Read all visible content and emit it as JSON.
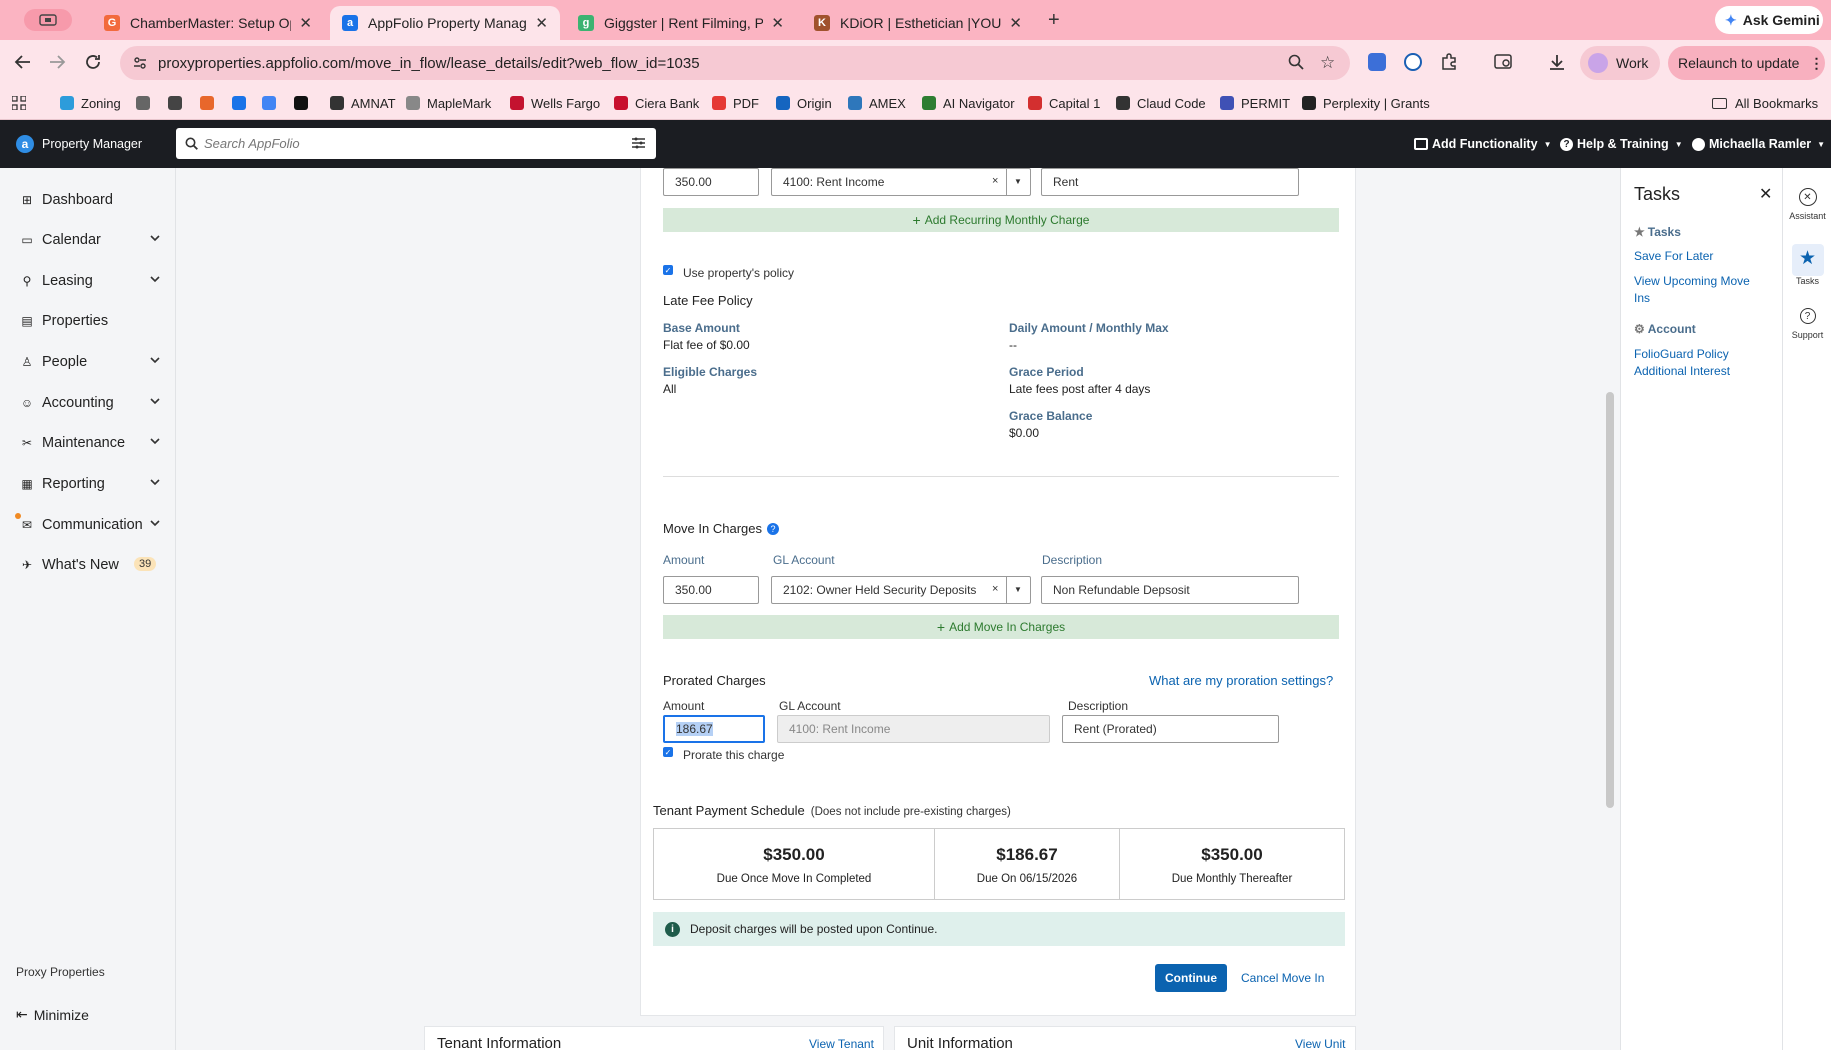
{
  "browser": {
    "tabs": [
      {
        "title": "ChamberMaster: Setup Optio",
        "fav_letter": "G",
        "fav_color": "#f26a3d"
      },
      {
        "title": "AppFolio Property Manager",
        "fav_letter": "a",
        "fav_color": "#1a73e8"
      },
      {
        "title": "Giggster | Rent Filming, Photo",
        "fav_letter": "g",
        "fav_color": "#3cb371"
      },
      {
        "title": "KDiOR | Esthetician |YOU DEF",
        "fav_letter": "K",
        "fav_color": "#a0522d"
      }
    ],
    "ask_gemini": "Ask Gemini",
    "url": "proxyproperties.appfolio.com/move_in_flow/lease_details/edit?web_flow_id=1035",
    "work_label": "Work",
    "relaunch_label": "Relaunch to update",
    "bookmarks": [
      {
        "label": "Zoning",
        "color": "#2d9cdb"
      },
      {
        "label": "",
        "color": "#666666"
      },
      {
        "label": "",
        "color": "#444444"
      },
      {
        "label": "",
        "color": "#e8672b"
      },
      {
        "label": "",
        "color": "#1a73e8"
      },
      {
        "label": "",
        "color": "#4285f4"
      },
      {
        "label": "",
        "color": "#111111"
      },
      {
        "label": "AMNAT",
        "color": "#333333"
      },
      {
        "label": "MapleMark",
        "color": "#888888"
      },
      {
        "label": "Wells Fargo",
        "color": "#c4122f"
      },
      {
        "label": "Ciera Bank",
        "color": "#c8102e"
      },
      {
        "label": "PDF",
        "color": "#e53935"
      },
      {
        "label": "Origin",
        "color": "#1565c0"
      },
      {
        "label": "AMEX",
        "color": "#2e77bb"
      },
      {
        "label": "AI Navigator",
        "color": "#2e7d32"
      },
      {
        "label": "Capital 1",
        "color": "#d32f2f"
      },
      {
        "label": "Claud Code",
        "color": "#333333"
      },
      {
        "label": "PERMIT",
        "color": "#3f51b5"
      },
      {
        "label": "Perplexity | Grants",
        "color": "#222222"
      }
    ],
    "all_bookmarks": "All Bookmarks"
  },
  "header": {
    "logo": "Property Manager",
    "search_placeholder": "Search AppFolio",
    "add_functionality": "Add Functionality",
    "help_training": "Help & Training",
    "user": "Michaella Ramler"
  },
  "sidebar": {
    "items": [
      {
        "label": "Dashboard",
        "chevron": false
      },
      {
        "label": "Calendar",
        "chevron": true
      },
      {
        "label": "Leasing",
        "chevron": true
      },
      {
        "label": "Properties",
        "chevron": false
      },
      {
        "label": "People",
        "chevron": true
      },
      {
        "label": "Accounting",
        "chevron": true
      },
      {
        "label": "Maintenance",
        "chevron": true
      },
      {
        "label": "Reporting",
        "chevron": true
      },
      {
        "label": "Communication",
        "chevron": true
      },
      {
        "label": "What's New",
        "chevron": false
      }
    ],
    "whats_new_count": "39",
    "company": "Proxy Properties",
    "minimize": "Minimize"
  },
  "recurring": {
    "amount": "350.00",
    "gl_account": "4100: Rent Income",
    "description": "Rent",
    "add_label": "Add Recurring Monthly Charge"
  },
  "policy": {
    "use_property_policy": "Use property's policy",
    "title": "Late Fee Policy",
    "base_amount_label": "Base Amount",
    "base_amount_value": "Flat fee of $0.00",
    "daily_label": "Daily Amount / Monthly Max",
    "daily_value": "--",
    "eligible_label": "Eligible Charges",
    "eligible_value": "All",
    "grace_period_label": "Grace Period",
    "grace_period_value": "Late fees post after 4 days",
    "grace_balance_label": "Grace Balance",
    "grace_balance_value": "$0.00"
  },
  "move_in": {
    "title": "Move In Charges",
    "amount_label": "Amount",
    "gl_label": "GL Account",
    "desc_label": "Description",
    "amount": "350.00",
    "gl_account": "2102: Owner Held Security Deposits",
    "description": "Non Refundable Depsosit",
    "add_label": "Add Move In Charges"
  },
  "prorated": {
    "title": "Prorated Charges",
    "settings_link": "What are my proration settings?",
    "amount_label": "Amount",
    "gl_label": "GL Account",
    "desc_label": "Description",
    "amount": "186.67",
    "gl_account": "4100: Rent Income",
    "description": "Rent (Prorated)",
    "prorate_label": "Prorate this charge"
  },
  "schedule": {
    "title": "Tenant Payment Schedule",
    "note": "(Does not include pre-existing charges)",
    "items": [
      {
        "amount": "$350.00",
        "label": "Due Once Move In Completed"
      },
      {
        "amount": "$186.67",
        "label": "Due On 06/15/2026"
      },
      {
        "amount": "$350.00",
        "label": "Due Monthly Thereafter"
      }
    ],
    "info": "Deposit charges will be posted upon Continue."
  },
  "actions": {
    "continue": "Continue",
    "cancel": "Cancel Move In"
  },
  "below": {
    "tenant_title": "Tenant Information",
    "view_tenant": "View Tenant",
    "unit_title": "Unit Information",
    "view_unit": "View Unit"
  },
  "tasks": {
    "title": "Tasks",
    "section_tasks": "Tasks",
    "save_for_later": "Save For Later",
    "view_upcoming": "View Upcoming Move Ins",
    "section_account": "Account",
    "folioguard": "FolioGuard Policy Additional Interest"
  },
  "rail": {
    "assistant": "Assistant",
    "tasks": "Tasks",
    "support": "Support"
  },
  "colors": {
    "brand_blue": "#0b63b0",
    "chrome_pink": "#fbb4c2",
    "header_dark": "#1b1d22",
    "add_green": "#2c7a2e"
  }
}
